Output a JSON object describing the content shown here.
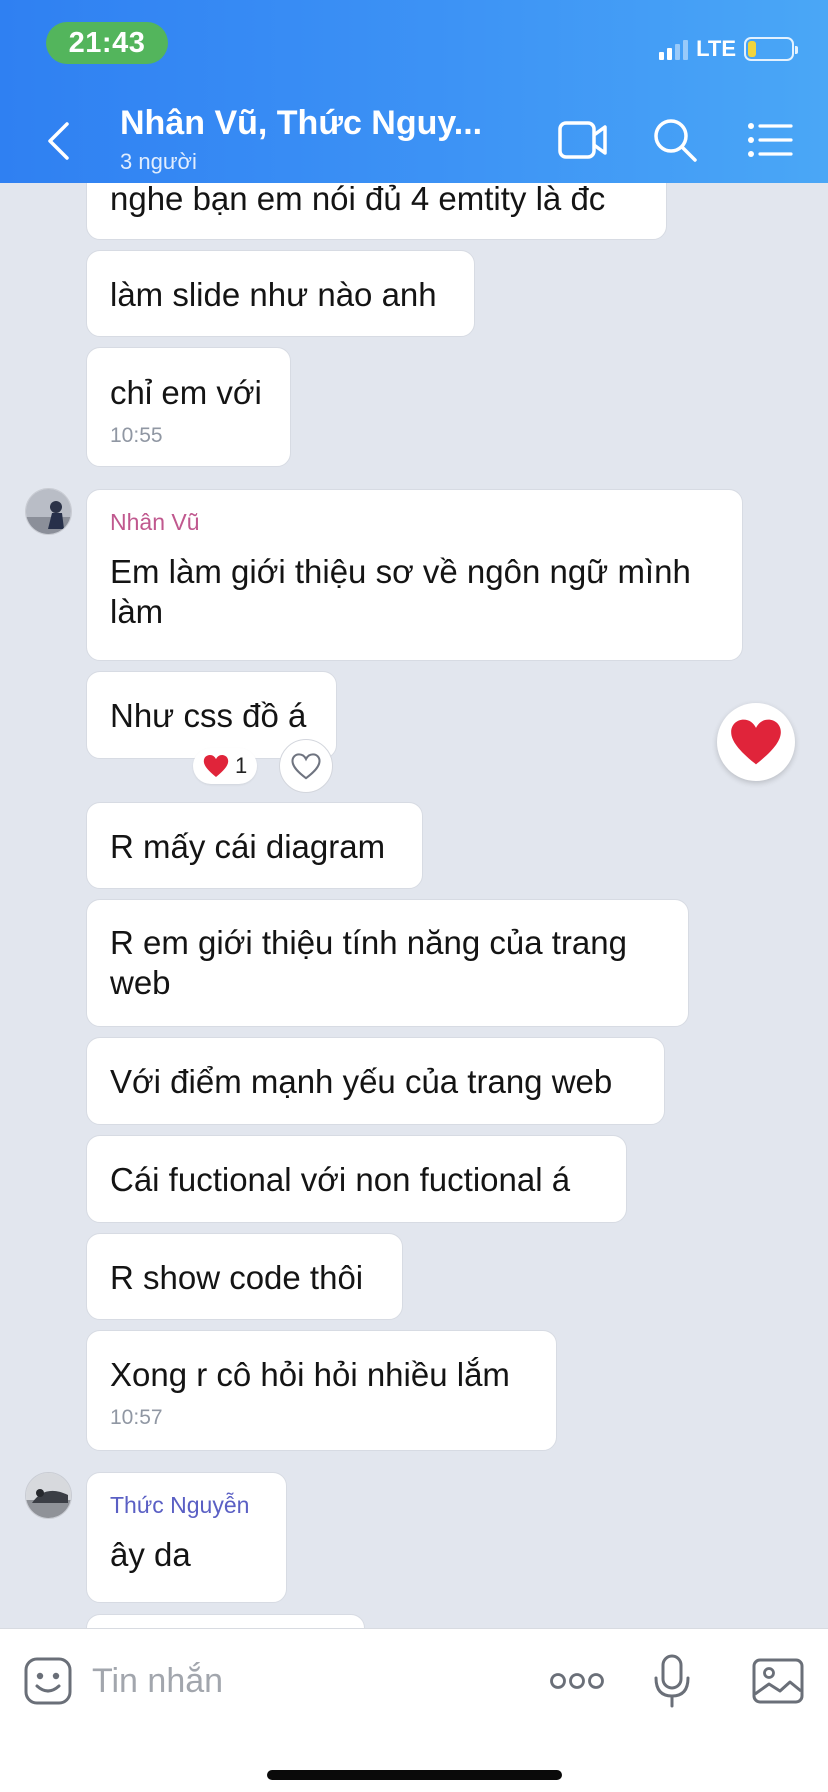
{
  "status_bar": {
    "time": "21:43",
    "network": "LTE",
    "signal_bars": 2,
    "battery_level": 0.2
  },
  "header": {
    "title": "Nhân Vũ, Thức Nguy...",
    "subtitle": "3 người",
    "icons": [
      "back-icon",
      "video-call-icon",
      "search-icon",
      "menu-list-icon"
    ],
    "gradient_start": "#2f80f2",
    "gradient_end": "#4aa7f6"
  },
  "messages": [
    {
      "text": "nghe bạn em nói đủ 4 emtity là đc"
    },
    {
      "text": "làm slide như nào anh"
    },
    {
      "text": "chỉ em với",
      "time": "10:55"
    },
    {
      "sender": "Nhân Vũ",
      "text": "Em làm giới thiệu sơ về ngôn ngữ mình làm"
    },
    {
      "text": "Như css đồ á",
      "reaction": {
        "emoji": "heart-icon",
        "count": "1"
      }
    },
    {
      "text": "R mấy cái diagram"
    },
    {
      "text": "R em giới thiệu tính năng của trang web"
    },
    {
      "text": "Với điểm mạnh yếu của trang web"
    },
    {
      "text": "Cái fuctional với non fuctional á"
    },
    {
      "text": "R show code thôi"
    },
    {
      "text": "Xong r cô hỏi hỏi nhiều lắm",
      "time": "10:57"
    },
    {
      "sender": "Thức Nguyễn",
      "text": "ây da"
    }
  ],
  "sender_colors": {
    "Nhân Vũ": "#c0588e",
    "Thức Nguyễn": "#5a5fc4"
  },
  "composer": {
    "placeholder": "Tin nhắn",
    "icons": [
      "sticker-icon",
      "more-icon",
      "microphone-icon",
      "image-icon"
    ]
  },
  "colors": {
    "background": "#e2e6ee",
    "bubble": "#ffffff",
    "heart": "#e0243a",
    "status_pill": "#53b55c",
    "battery": "#f2d43c"
  }
}
